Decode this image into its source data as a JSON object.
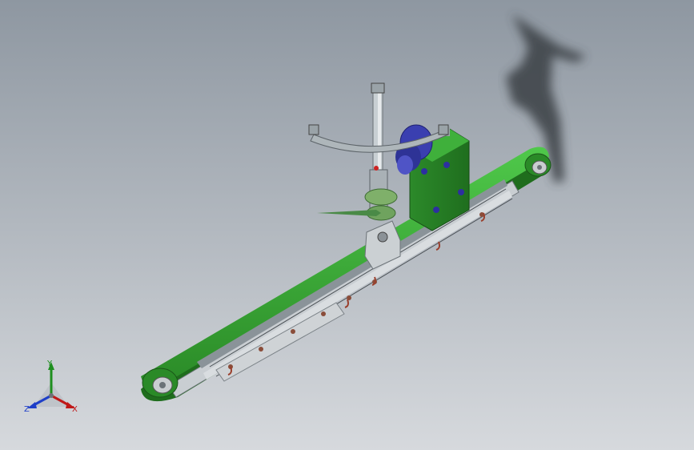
{
  "scene": {
    "background_top": "#8e97a1",
    "background_bottom": "#d6d9dd",
    "assembly_color": "#2f9a2c",
    "motor_color": "#3a3fb0",
    "frame_color": "#9aa3a8"
  },
  "triad": {
    "y_label": "Y",
    "x_label": "X",
    "z_label": "Z",
    "y_color": "#1f8f1f",
    "x_color": "#c01818",
    "z_color": "#1e3fc8"
  }
}
